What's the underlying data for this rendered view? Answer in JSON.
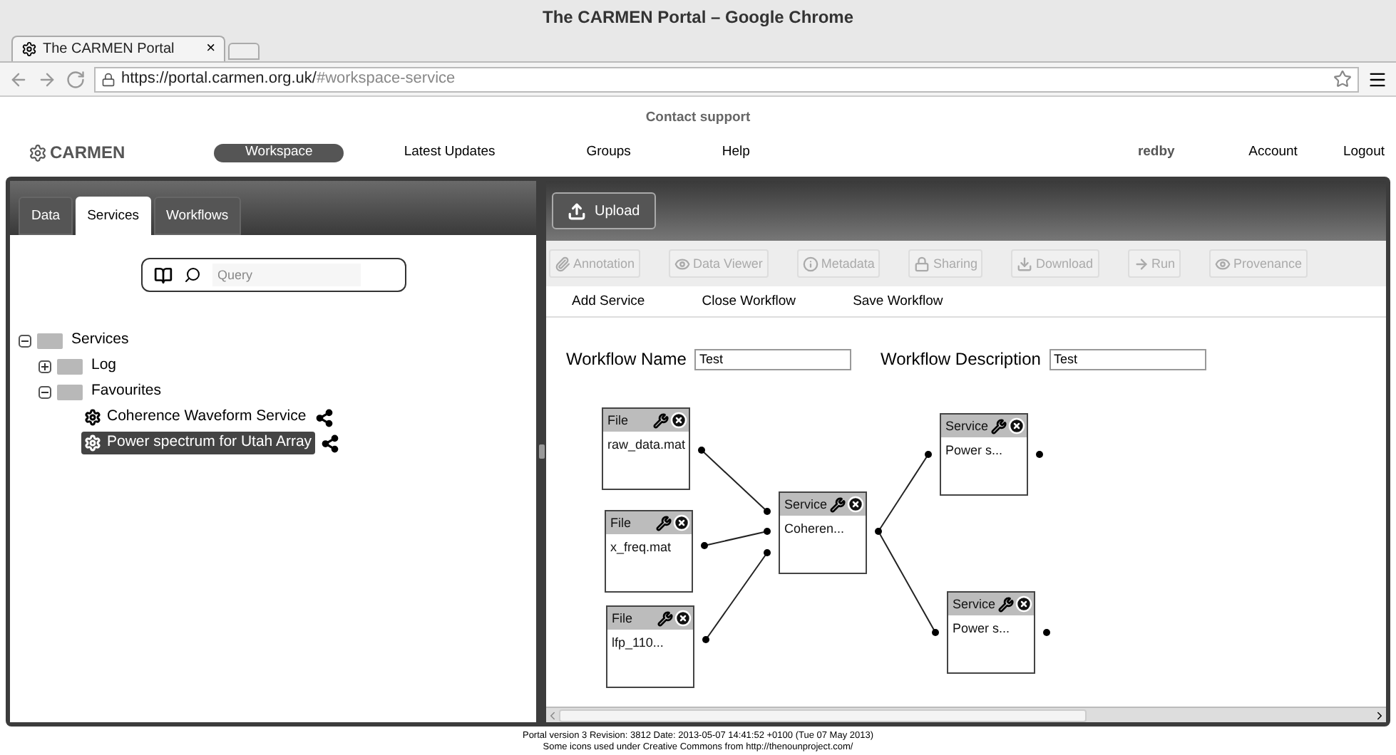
{
  "window": {
    "title": "The CARMEN Portal – Google Chrome"
  },
  "browser_tab": {
    "title": "The CARMEN Portal",
    "close": "×"
  },
  "address_bar": {
    "host": "https://portal.carmen.org.uk/",
    "path": "#workspace-service"
  },
  "contact": "Contact support",
  "logo": "CARMEN",
  "nav": [
    {
      "label": "Workspace",
      "selected": true
    },
    {
      "label": "Latest Updates",
      "selected": false
    },
    {
      "label": "Groups",
      "selected": false
    },
    {
      "label": "Help",
      "selected": false
    }
  ],
  "user": "redby",
  "account_links": [
    "Account",
    "Logout"
  ],
  "left_tabs": [
    {
      "label": "Data",
      "selected": false
    },
    {
      "label": "Services",
      "selected": true
    },
    {
      "label": "Workflows",
      "selected": false
    }
  ],
  "search": {
    "placeholder": "Query"
  },
  "tree": [
    {
      "label": "Services",
      "kind": "folder",
      "expanded": true,
      "selected": false,
      "children": [
        {
          "label": "Log",
          "kind": "folder",
          "expanded": false,
          "selected": false
        },
        {
          "label": "Favourites",
          "kind": "folder",
          "expanded": true,
          "selected": false,
          "children": [
            {
              "label": "Coherence Waveform Service",
              "kind": "service",
              "selected": false
            },
            {
              "label": "Power spectrum for Utah Array",
              "kind": "service",
              "selected": true
            }
          ]
        }
      ]
    }
  ],
  "upload_button": "Upload",
  "toolbar": [
    {
      "label": "Annotation",
      "kind": "clip",
      "disabled": true
    },
    {
      "label": "Data Viewer",
      "kind": "eye",
      "disabled": true
    },
    {
      "label": "Metadata",
      "kind": "info",
      "disabled": true
    },
    {
      "label": "Sharing",
      "kind": "lock",
      "disabled": true
    },
    {
      "label": "Download",
      "kind": "download",
      "disabled": true
    },
    {
      "label": "Run",
      "kind": "run",
      "disabled": true
    },
    {
      "label": "Provenance",
      "kind": "eye",
      "disabled": true
    }
  ],
  "menu": [
    "Add Service",
    "Close Workflow",
    "Save Workflow"
  ],
  "workflow_name": {
    "label": "Workflow Name",
    "value": "Test"
  },
  "workflow_description": {
    "label": "Workflow Description",
    "value": "Test"
  },
  "nodes": [
    {
      "header": "File",
      "label": "raw_data.mat"
    },
    {
      "header": "File",
      "label": "x_freq.mat"
    },
    {
      "header": "File",
      "label": "lfp_110..."
    },
    {
      "header": "Service",
      "label": "Coheren..."
    },
    {
      "header": "Service",
      "label": "Power s..."
    },
    {
      "header": "Service",
      "label": "Power s..."
    }
  ],
  "footer": [
    "Portal version 3 Revision: 3812 Date: 2013-05-07 14:41:52 +0100 (Tue 07 May 2013)",
    "Some icons used under Creative Commons from http://thenounproject.com/"
  ]
}
